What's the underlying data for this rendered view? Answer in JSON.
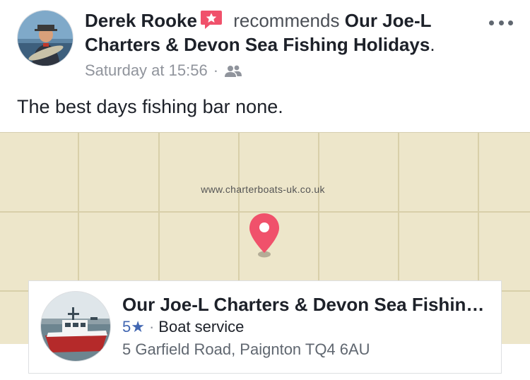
{
  "post": {
    "author": "Derek Rooke",
    "action": "recommends",
    "page_name": "Our Joe-L Charters & Devon Sea Fishing Holidays",
    "page_suffix": ".",
    "timestamp": "Saturday at 15:56",
    "separator": "·",
    "audience_icon": "friends-icon",
    "recommend_icon": "recommendation-star-icon",
    "text": "The best days fishing bar none."
  },
  "map": {
    "watermark": "www.charterboats-uk.co.uk",
    "pin_color": "#f0516b",
    "background": "#ede6ca"
  },
  "place_card": {
    "title": "Our Joe-L Charters & Devon Sea Fishing Holidays",
    "rating": "5★",
    "separator": "·",
    "category": "Boat service",
    "address": "5 Garfield Road, Paignton TQ4 6AU"
  },
  "colors": {
    "accent_blue": "#4267b2",
    "recommend_red": "#f0516b",
    "secondary_text": "#90949c"
  }
}
